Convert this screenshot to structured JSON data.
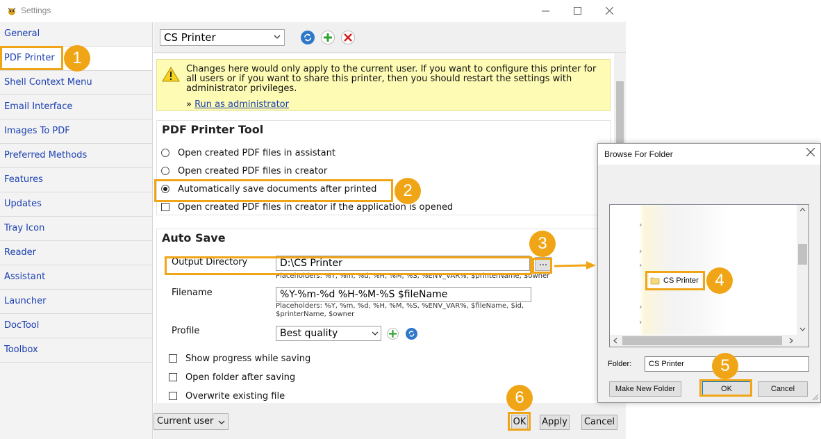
{
  "window": {
    "title": "Settings",
    "minimize_glyph": "—",
    "maximize_glyph": "☐",
    "close_glyph": "✕"
  },
  "sidebar": {
    "items": [
      {
        "label": "General"
      },
      {
        "label": "PDF Printer"
      },
      {
        "label": "Shell Context Menu"
      },
      {
        "label": "Email Interface"
      },
      {
        "label": "Images To PDF"
      },
      {
        "label": "Preferred Methods"
      },
      {
        "label": "Features"
      },
      {
        "label": "Updates"
      },
      {
        "label": "Tray Icon"
      },
      {
        "label": "Reader"
      },
      {
        "label": "Assistant"
      },
      {
        "label": "Launcher"
      },
      {
        "label": "DocTool"
      },
      {
        "label": "Toolbox"
      }
    ],
    "selected_index": 1
  },
  "toolbar": {
    "printer_value": "CS Printer",
    "icons": [
      "refresh-icon",
      "add-icon",
      "delete-icon"
    ]
  },
  "warning": {
    "text": "Changes here would only apply to the current user. If you want to configure this printer for all users or if you want to share this printer, then you should restart the settings with administrator privileges.",
    "link_prefix": "»",
    "link_label": "Run as administrator"
  },
  "pdf_printer_tool": {
    "title": "PDF Printer Tool",
    "options": [
      {
        "label": "Open created PDF files in assistant",
        "type": "radio",
        "checked": false
      },
      {
        "label": "Open created PDF files in creator",
        "type": "radio",
        "checked": false
      },
      {
        "label": "Automatically save documents after printed",
        "type": "radio",
        "checked": true
      },
      {
        "label": "Open created PDF files in creator if the application is opened",
        "type": "checkbox",
        "checked": false
      }
    ]
  },
  "auto_save": {
    "title": "Auto Save",
    "output_directory_label": "Output Directory",
    "output_directory_value": "D:\\CS Printer",
    "browse_label": "...",
    "output_directory_hint": "Placeholders: %Y, %m, %d, %H, %M, %S, %ENV_VAR%, $printerName, $owner",
    "filename_label": "Filename",
    "filename_value": "%Y-%m-%d %H-%M-%S $fileName",
    "filename_hint_line1": "Placeholders: %Y, %m, %d, %H, %M, %S, %ENV_VAR%, $fileName, $id,",
    "filename_hint_line2": "$printerName, $owner",
    "profile_label": "Profile",
    "profile_value": "Best quality",
    "checkboxes": [
      {
        "label": "Show progress while saving",
        "checked": false
      },
      {
        "label": "Open folder after saving",
        "checked": false
      },
      {
        "label": "Overwrite existing file",
        "checked": false
      }
    ]
  },
  "bottom": {
    "scope_value": "Current user",
    "ok_label": "OK",
    "apply_label": "Apply",
    "cancel_label": "Cancel"
  },
  "browse_dialog": {
    "title": "Browse For Folder",
    "tree_selected_label": "CS Printer",
    "folder_label": "Folder:",
    "folder_value": "CS Printer",
    "make_new_folder_label": "Make New Folder",
    "ok_label": "OK",
    "cancel_label": "Cancel"
  },
  "annotations": {
    "callouts": [
      "1",
      "2",
      "3",
      "4",
      "5",
      "6"
    ],
    "accent_color": "#f0a516"
  }
}
